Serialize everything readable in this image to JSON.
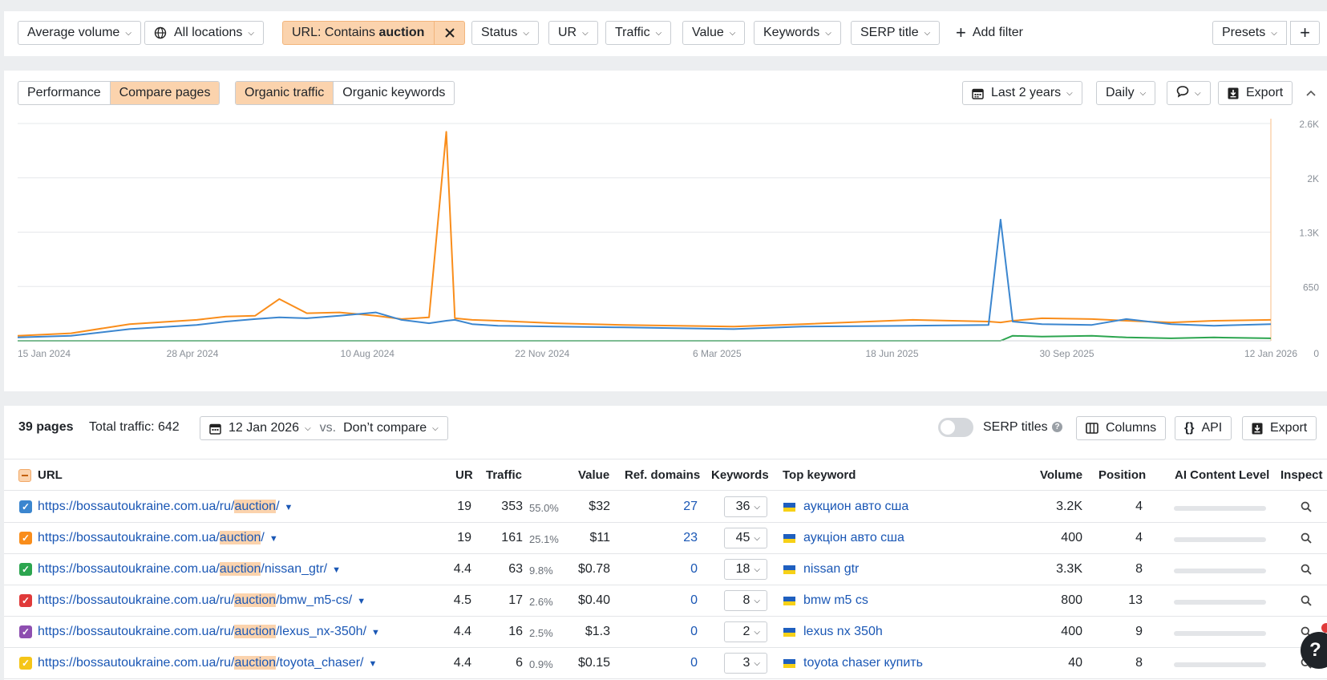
{
  "filters": {
    "average_volume": "Average volume",
    "locations": "All locations",
    "url_prefix": "URL: Contains ",
    "url_value": "auction",
    "status": "Status",
    "ur": "UR",
    "traffic": "Traffic",
    "value": "Value",
    "keywords": "Keywords",
    "serp_title": "SERP title",
    "add_filter": "Add filter",
    "presets": "Presets"
  },
  "chart_controls": {
    "performance": "Performance",
    "compare_pages": "Compare pages",
    "organic_traffic": "Organic traffic",
    "organic_keywords": "Organic keywords",
    "period": "Last 2 years",
    "interval": "Daily",
    "export": "Export"
  },
  "colors": {
    "series_orange": "#f98d1b",
    "series_blue": "#3b86cf",
    "series_green": "#2ca54f",
    "series_yellow": "#f5c518",
    "series_purple": "#8e4fb0",
    "series_red": "#e03a3a",
    "accent": "#fbd3ad",
    "link": "#1a57b5"
  },
  "chart_data": {
    "type": "line",
    "x_tick_labels": [
      "15 Jan 2024",
      "28 Apr 2024",
      "10 Aug 2024",
      "22 Nov 2024",
      "6 Mar 2025",
      "18 Jun 2025",
      "30 Sep 2025",
      "12 Jan 2026"
    ],
    "y_tick_labels": [
      "0",
      "650",
      "1.3K",
      "2K",
      "2.6K"
    ],
    "ylim": [
      0,
      2600
    ],
    "grid": true,
    "x": [
      "2024-01-15",
      "2024-02-15",
      "2024-03-20",
      "2024-04-28",
      "2024-05-15",
      "2024-06-01",
      "2024-06-15",
      "2024-07-01",
      "2024-07-20",
      "2024-08-10",
      "2024-08-25",
      "2024-09-10",
      "2024-09-20",
      "2024-09-25",
      "2024-10-05",
      "2024-10-20",
      "2024-11-22",
      "2025-01-01",
      "2025-03-06",
      "2025-04-15",
      "2025-06-18",
      "2025-08-01",
      "2025-08-08",
      "2025-08-15",
      "2025-09-01",
      "2025-09-30",
      "2025-10-20",
      "2025-11-15",
      "2025-12-10",
      "2026-01-12"
    ],
    "series": [
      {
        "values": [
          60,
          90,
          200,
          250,
          290,
          300,
          500,
          330,
          340,
          300,
          260,
          280,
          2500,
          270,
          250,
          240,
          210,
          190,
          170,
          200,
          250,
          230,
          220,
          240,
          270,
          260,
          240,
          220,
          240,
          250
        ]
      },
      {
        "values": [
          40,
          60,
          140,
          190,
          230,
          260,
          280,
          270,
          300,
          340,
          250,
          210,
          240,
          250,
          200,
          180,
          170,
          160,
          140,
          170,
          180,
          190,
          1450,
          230,
          200,
          190,
          260,
          200,
          180,
          200
        ]
      },
      {
        "values": [
          0,
          0,
          0,
          0,
          0,
          0,
          0,
          0,
          0,
          0,
          0,
          0,
          0,
          0,
          0,
          0,
          0,
          0,
          0,
          0,
          0,
          0,
          0,
          60,
          50,
          60,
          40,
          30,
          40,
          30
        ]
      }
    ]
  },
  "table_toolbar": {
    "pages_count": "39 pages",
    "total_traffic": "Total traffic: 642",
    "date": "12 Jan 2026",
    "vs": "vs.",
    "compare": "Don’t compare",
    "serp_titles": "SERP titles",
    "columns": "Columns",
    "api": "API",
    "export": "Export"
  },
  "table": {
    "headers": {
      "url": "URL",
      "ur": "UR",
      "traffic": "Traffic",
      "value": "Value",
      "ref_domains": "Ref. domains",
      "keywords": "Keywords",
      "top_keyword": "Top keyword",
      "volume": "Volume",
      "position": "Position",
      "ai": "AI Content Level",
      "inspect": "Inspect"
    },
    "rows": [
      {
        "url_pre": "https://bossautoukraine.com.ua/ru/",
        "url_hl": "auction",
        "url_post": "/",
        "color": "#3b86cf",
        "ur": "19",
        "traffic": "353",
        "pct": "55.0%",
        "value": "$32",
        "ref": "27",
        "kw": "36",
        "top": "аукцион авто сша",
        "volume": "3.2K",
        "position": "4"
      },
      {
        "url_pre": "https://bossautoukraine.com.ua/",
        "url_hl": "auction",
        "url_post": "/",
        "color": "#f98d1b",
        "ur": "19",
        "traffic": "161",
        "pct": "25.1%",
        "value": "$11",
        "ref": "23",
        "kw": "45",
        "top": "аукціон авто сша",
        "volume": "400",
        "position": "4"
      },
      {
        "url_pre": "https://bossautoukraine.com.ua/",
        "url_hl": "auction",
        "url_post": "/nissan_gtr/",
        "color": "#2ca54f",
        "ur": "4.4",
        "traffic": "63",
        "pct": "9.8%",
        "value": "$0.78",
        "ref": "0",
        "kw": "18",
        "top": "nissan gtr",
        "volume": "3.3K",
        "position": "8"
      },
      {
        "url_pre": "https://bossautoukraine.com.ua/ru/",
        "url_hl": "auction",
        "url_post": "/bmw_m5-cs/",
        "color": "#e03a3a",
        "ur": "4.5",
        "traffic": "17",
        "pct": "2.6%",
        "value": "$0.40",
        "ref": "0",
        "kw": "8",
        "top": "bmw m5 cs",
        "volume": "800",
        "position": "13"
      },
      {
        "url_pre": "https://bossautoukraine.com.ua/ru/",
        "url_hl": "auction",
        "url_post": "/lexus_nx-350h/",
        "color": "#8e4fb0",
        "ur": "4.4",
        "traffic": "16",
        "pct": "2.5%",
        "value": "$1.3",
        "ref": "0",
        "kw": "2",
        "top": "lexus nx 350h",
        "volume": "400",
        "position": "9"
      },
      {
        "url_pre": "https://bossautoukraine.com.ua/ru/",
        "url_hl": "auction",
        "url_post": "/toyota_chaser/",
        "color": "#f5c518",
        "ur": "4.4",
        "traffic": "6",
        "pct": "0.9%",
        "value": "$0.15",
        "ref": "0",
        "kw": "3",
        "top": "toyota chaser купить",
        "volume": "40",
        "position": "8"
      }
    ]
  },
  "help_label": "?"
}
